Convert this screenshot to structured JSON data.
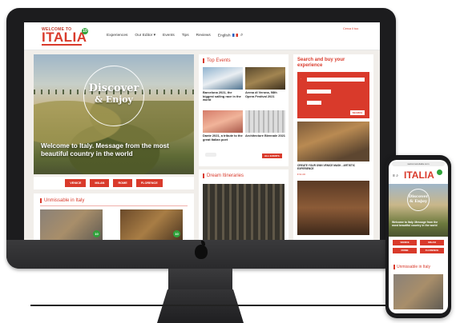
{
  "site": {
    "logo_small": "WELCOME TO",
    "logo_main": "ITALIA",
    "logo_badge": "10",
    "nav": [
      "Experiences",
      "Our Editor",
      "Events",
      "Tips",
      "Reviews",
      "English"
    ],
    "header_right": "Cerca il tuo"
  },
  "hero": {
    "word1": "Discover",
    "word2": "& Enjoy",
    "caption": "Welcome to Italy. Message from the most beautiful country in the world",
    "cities": [
      "VENICE",
      "MILAN",
      "ROME",
      "FLORENCE"
    ]
  },
  "unmissable": {
    "title": "Unmissable in Italy",
    "badge": "10"
  },
  "top_events": {
    "title": "Top Events",
    "items": [
      {
        "text": "Barcelona 2021, the biggest sailing race in the world"
      },
      {
        "text": "Arena di Verona, 98th Opera Festival 2021"
      },
      {
        "text": "Dante 2021, a tribute to the great Italian poet"
      },
      {
        "text": "Architecture Biennale 2021"
      }
    ],
    "more": "ALL EVENTS"
  },
  "dream": {
    "title": "Dream Itineraries"
  },
  "search_box": {
    "title": "Search and buy your experience",
    "caption": "CREATE YOUR OWN VENICE MASK - ARTISTIC EXPERIENCE",
    "price": "€ 91.00",
    "go": "SEARCH"
  },
  "phone": {
    "url": "welcometoitalia.com",
    "logo": "ITALIA",
    "hero_word": "Discover & Enjoy",
    "hero_caption": "Welcome to Italy. Message from the most beautiful country in the world",
    "buttons": [
      "VENICE",
      "MILAN",
      "ROME",
      "FLORENCE"
    ],
    "unmissable": "Unmissable in Italy"
  }
}
